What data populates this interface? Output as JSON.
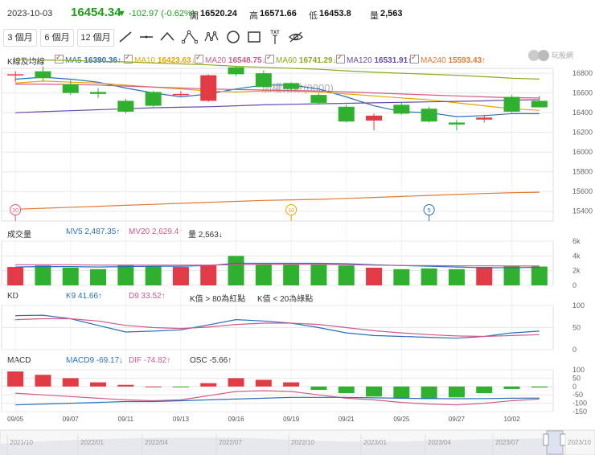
{
  "header": {
    "date": "2023-10-03",
    "price": "16454.34",
    "change": "▼ -102.97 (-0.62%)",
    "open_label": "開",
    "open": "16520.24",
    "high_label": "高",
    "high": "16571.66",
    "low_label": "低",
    "low": "16453.8",
    "vol_label": "量",
    "vol": "2,563"
  },
  "periods": [
    "3 個月",
    "6 個月",
    "12 個月"
  ],
  "tools": [
    "line-tool-icon",
    "horizontal-line-tool-icon",
    "polyline-tool-icon",
    "triangle-tool-icon",
    "wave-tool-icon",
    "circle-tool-icon",
    "rectangle-tool-icon",
    "text-tool-icon",
    "hide-icon"
  ],
  "tool_text_label": "TXT",
  "logo_text": "玩股網",
  "kline_legend": {
    "title": "K線及均線",
    "items": [
      {
        "name": "MA5",
        "value": "16390.36↑",
        "color": "#2a6fb8"
      },
      {
        "name": "MA10",
        "value": "16423.63↓",
        "color": "#e8a300"
      },
      {
        "name": "MA20",
        "value": "16548.75↓",
        "color": "#d05a8a"
      },
      {
        "name": "MA60",
        "value": "16741.29↓",
        "color": "#8aab1f"
      },
      {
        "name": "MA120",
        "value": "16531.91↑",
        "color": "#6a4aa8"
      },
      {
        "name": "MA240",
        "value": "15593.43↑",
        "color": "#e07838"
      }
    ]
  },
  "watermark": "加權指數(0000)",
  "volume_legend": {
    "title": "成交量",
    "mv5": "MV5 2,487.35↑",
    "mv20": "MV20 2,629.4↑",
    "vol": "量 2,563↓"
  },
  "kd_legend": {
    "title": "KD",
    "k9": "K9 41.66↑",
    "d9": "D9 33.52↑",
    "note1": "K值 > 80為紅點",
    "note2": "K值 < 20為綠點"
  },
  "macd_legend": {
    "title": "MACD",
    "macd9": "MACD9 -69.17↓",
    "dif": "DIF -74.82↑",
    "osc": "OSC -5.66↑"
  },
  "markers": [
    "20",
    "10",
    "5"
  ],
  "navigator_labels": [
    "2021/10",
    "2022/01",
    "2022/04",
    "2022/07",
    "2022/10",
    "2023/01",
    "2023/04",
    "2023/07",
    "2023/10"
  ],
  "colors": {
    "up": "#e23b45",
    "down": "#2fb12f",
    "grid": "#e8e8e8"
  },
  "chart_data": [
    {
      "type": "candlestick",
      "title": "加權指數(0000)",
      "x": [
        "09/05",
        "09/06",
        "09/07",
        "09/08",
        "09/11",
        "09/12",
        "09/13",
        "09/14",
        "09/15",
        "09/18",
        "09/19",
        "09/20",
        "09/21",
        "09/22",
        "09/25",
        "09/26",
        "09/27",
        "09/28",
        "10/02",
        "10/03"
      ],
      "x_ticks": [
        "09/05",
        "09/07",
        "09/11",
        "09/13",
        "09/16",
        "09/19",
        "09/21",
        "09/25",
        "09/27",
        "10/02"
      ],
      "open": [
        16780,
        16820,
        16690,
        16610,
        16520,
        16610,
        16580,
        16520,
        16860,
        16800,
        16700,
        16580,
        16460,
        16320,
        16480,
        16440,
        16300,
        16330,
        16560,
        16520
      ],
      "close": [
        16790,
        16750,
        16600,
        16590,
        16410,
        16470,
        16590,
        16780,
        16790,
        16660,
        16640,
        16500,
        16310,
        16370,
        16390,
        16310,
        16280,
        16350,
        16410,
        16454
      ],
      "high": [
        16820,
        16870,
        16730,
        16650,
        16540,
        16620,
        16620,
        16790,
        16870,
        16830,
        16710,
        16600,
        16480,
        16390,
        16500,
        16460,
        16330,
        16380,
        16580,
        16572
      ],
      "low": [
        16710,
        16720,
        16580,
        16550,
        16390,
        16460,
        16560,
        16510,
        16770,
        16650,
        16620,
        16480,
        16300,
        16220,
        16380,
        16300,
        16220,
        16300,
        16400,
        16454
      ],
      "ylim": [
        15300,
        16850
      ],
      "y_ticks": [
        15400,
        15600,
        15800,
        16000,
        16200,
        16400,
        16600,
        16800
      ],
      "series": [
        {
          "name": "MA5",
          "color": "#2a6fb8",
          "values": [
            16740,
            16760,
            16740,
            16710,
            16650,
            16600,
            16560,
            16590,
            16640,
            16680,
            16680,
            16640,
            16560,
            16470,
            16410,
            16400,
            16360,
            16370,
            16390,
            16390
          ]
        },
        {
          "name": "MA10",
          "color": "#e8a300",
          "values": [
            16700,
            16720,
            16710,
            16700,
            16680,
            16660,
            16640,
            16620,
            16610,
            16620,
            16620,
            16610,
            16590,
            16570,
            16550,
            16530,
            16500,
            16470,
            16440,
            16424
          ]
        },
        {
          "name": "MA20",
          "color": "#d05a8a",
          "values": [
            16690,
            16690,
            16685,
            16680,
            16670,
            16660,
            16650,
            16640,
            16635,
            16630,
            16625,
            16620,
            16610,
            16600,
            16590,
            16580,
            16570,
            16560,
            16552,
            16549
          ]
        },
        {
          "name": "MA60",
          "color": "#8aab1f",
          "values": [
            16940,
            16935,
            16930,
            16920,
            16915,
            16905,
            16895,
            16885,
            16870,
            16860,
            16850,
            16840,
            16825,
            16810,
            16800,
            16790,
            16780,
            16765,
            16750,
            16741
          ]
        },
        {
          "name": "MA120",
          "color": "#6a4aa8",
          "values": [
            16400,
            16410,
            16420,
            16430,
            16440,
            16450,
            16455,
            16460,
            16470,
            16480,
            16485,
            16490,
            16495,
            16500,
            16505,
            16510,
            16515,
            16520,
            16528,
            16532
          ]
        },
        {
          "name": "MA240",
          "color": "#e07838",
          "values": [
            15420,
            15430,
            15440,
            15450,
            15460,
            15470,
            15480,
            15490,
            15500,
            15510,
            15515,
            15520,
            15530,
            15540,
            15550,
            15560,
            15570,
            15580,
            15588,
            15593
          ]
        }
      ]
    },
    {
      "type": "bar",
      "title": "成交量",
      "values": [
        2.5,
        2.7,
        2.4,
        2.2,
        2.8,
        2.6,
        2.5,
        2.7,
        4.0,
        2.8,
        2.8,
        2.8,
        2.7,
        2.4,
        2.2,
        2.3,
        2.2,
        2.5,
        2.6,
        2.56
      ],
      "ylim": [
        0,
        6
      ],
      "y_ticks": [
        "0",
        "2k",
        "4k",
        "6k"
      ],
      "y_tick_values": [
        0,
        2,
        4,
        6
      ],
      "series": [
        {
          "name": "MV5",
          "color": "#2a6fb8",
          "values": [
            2.5,
            2.55,
            2.55,
            2.5,
            2.55,
            2.6,
            2.6,
            2.7,
            3.0,
            3.0,
            3.0,
            3.0,
            2.95,
            2.8,
            2.7,
            2.6,
            2.5,
            2.4,
            2.4,
            2.45
          ]
        },
        {
          "name": "MV20",
          "color": "#d05a8a",
          "values": [
            2.8,
            2.8,
            2.8,
            2.75,
            2.75,
            2.75,
            2.75,
            2.75,
            2.8,
            2.85,
            2.85,
            2.85,
            2.8,
            2.75,
            2.7,
            2.7,
            2.65,
            2.65,
            2.63,
            2.63
          ]
        }
      ]
    },
    {
      "type": "line",
      "title": "KD",
      "ylim": [
        0,
        100
      ],
      "y_ticks": [
        0,
        50,
        100
      ],
      "series": [
        {
          "name": "K9",
          "color": "#2a6fb8",
          "values": [
            77,
            78,
            70,
            55,
            40,
            42,
            45,
            56,
            68,
            65,
            60,
            50,
            38,
            32,
            30,
            28,
            26,
            30,
            38,
            42
          ]
        },
        {
          "name": "D9",
          "color": "#d05a8a",
          "values": [
            68,
            70,
            70,
            65,
            55,
            50,
            48,
            51,
            57,
            60,
            60,
            57,
            50,
            43,
            38,
            34,
            31,
            30,
            32,
            34
          ]
        }
      ]
    },
    {
      "type": "bar",
      "title": "MACD",
      "values": [
        90,
        70,
        50,
        25,
        10,
        0,
        -5,
        20,
        50,
        40,
        25,
        -20,
        -40,
        -60,
        -70,
        -75,
        -65,
        -40,
        -15,
        -6
      ],
      "ylim": [
        -150,
        100
      ],
      "y_ticks": [
        -150,
        -100,
        -50,
        0,
        50,
        100
      ],
      "series": [
        {
          "name": "DIF",
          "color": "#d05a8a",
          "values": [
            -40,
            -50,
            -60,
            -70,
            -80,
            -85,
            -80,
            -55,
            -30,
            -25,
            -30,
            -50,
            -70,
            -80,
            -95,
            -105,
            -110,
            -100,
            -85,
            -75
          ]
        },
        {
          "name": "MACD9",
          "color": "#2a6fb8",
          "values": [
            -110,
            -105,
            -100,
            -95,
            -90,
            -90,
            -85,
            -80,
            -75,
            -70,
            -65,
            -65,
            -65,
            -68,
            -70,
            -72,
            -73,
            -72,
            -70,
            -69
          ]
        }
      ]
    }
  ]
}
